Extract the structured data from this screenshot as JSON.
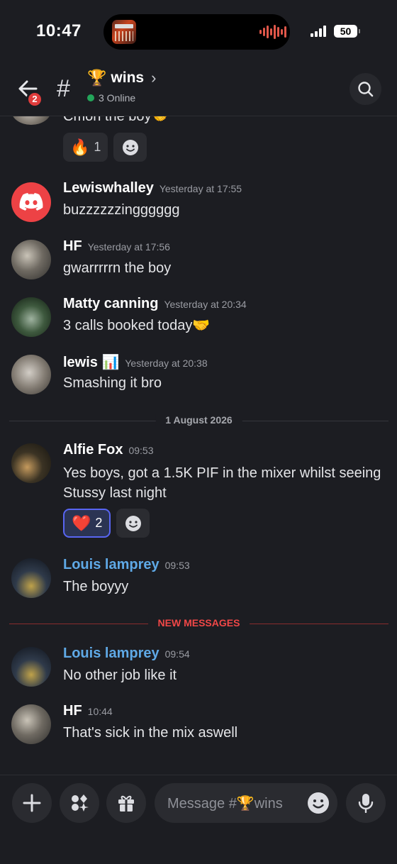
{
  "status_bar": {
    "time": "10:47",
    "battery": "50"
  },
  "header": {
    "back_badge": "2",
    "channel_emoji": "🏆",
    "channel_name": "wins",
    "online_text": "3 Online"
  },
  "colors": {
    "background": "#1c1d22",
    "online": "#23a55a",
    "accent_blue": "#5865f2",
    "new_messages": "#f04747",
    "username_highlight": "#5fa9e6"
  },
  "messages": [
    {
      "id": "partial",
      "body": "Cmon the boy🤝",
      "reactions": [
        {
          "emoji": "🔥",
          "count": "1",
          "active": false
        }
      ]
    },
    {
      "id": "lewiswhalley",
      "author": "Lewiswhalley",
      "timestamp": "Yesterday at 17:55",
      "body": "buzzzzzzingggggg",
      "avatar": "discord-logo"
    },
    {
      "id": "hf1",
      "author": "HF",
      "timestamp": "Yesterday at 17:56",
      "body": "gwarrrrrn the boy"
    },
    {
      "id": "matty",
      "author": "Matty canning",
      "timestamp": "Yesterday at 20:34",
      "body": "3 calls booked today🤝"
    },
    {
      "id": "lewis",
      "author": "lewis 📊",
      "timestamp": "Yesterday at 20:38",
      "body": "Smashing it bro"
    },
    {
      "id": "alfie",
      "author": "Alfie Fox",
      "timestamp": "09:53",
      "body": "Yes boys, got a 1.5K PIF in the mixer whilst seeing Stussy last night",
      "reactions": [
        {
          "emoji": "❤️",
          "count": "2",
          "active": true
        }
      ]
    },
    {
      "id": "louis1",
      "author": "Louis lamprey",
      "timestamp": "09:53",
      "body": "The boyyy"
    },
    {
      "id": "louis2",
      "author": "Louis lamprey",
      "timestamp": "09:54",
      "body": "No other job like it"
    },
    {
      "id": "hf2",
      "author": "HF",
      "timestamp": "10:44",
      "body": "That's sick in the mix aswell"
    }
  ],
  "dividers": {
    "date": "1 August 2026",
    "new_messages": "NEW MESSAGES"
  },
  "composer": {
    "placeholder": "Message #🏆wins"
  }
}
